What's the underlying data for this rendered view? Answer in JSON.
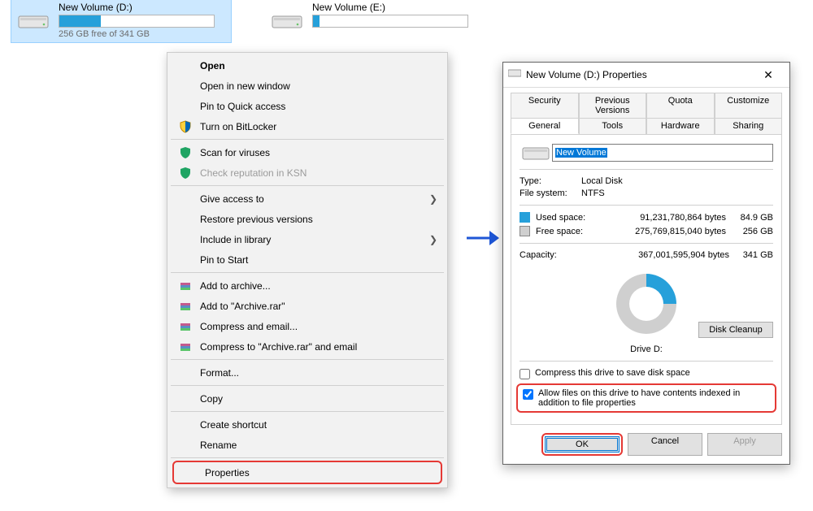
{
  "drives": [
    {
      "name": "New Volume (D:)",
      "free": "256 GB free of 341 GB",
      "used_pct": 27,
      "selected": true
    },
    {
      "name": "New Volume (E:)",
      "free": "",
      "used_pct": 4,
      "selected": false
    }
  ],
  "context_menu": {
    "open": "Open",
    "open_new_window": "Open in new window",
    "pin_quick": "Pin to Quick access",
    "bitlocker": "Turn on BitLocker",
    "scan_virus": "Scan for viruses",
    "check_ksn": "Check reputation in KSN",
    "give_access": "Give access to",
    "restore_prev": "Restore previous versions",
    "include_lib": "Include in library",
    "pin_start": "Pin to Start",
    "add_archive": "Add to archive...",
    "add_archive_rar": "Add to \"Archive.rar\"",
    "compress_email": "Compress and email...",
    "compress_rar_email": "Compress to \"Archive.rar\" and email",
    "format": "Format...",
    "copy": "Copy",
    "create_shortcut": "Create shortcut",
    "rename": "Rename",
    "properties": "Properties"
  },
  "dialog": {
    "title": "New Volume (D:) Properties",
    "tabs_row1": [
      "Security",
      "Previous Versions",
      "Quota",
      "Customize"
    ],
    "tabs_row2": [
      "General",
      "Tools",
      "Hardware",
      "Sharing"
    ],
    "volume_value": "New Volume",
    "type_label": "Type:",
    "type_value": "Local Disk",
    "fs_label": "File system:",
    "fs_value": "NTFS",
    "used_label": "Used space:",
    "used_bytes": "91,231,780,864 bytes",
    "used_h": "84.9 GB",
    "free_label": "Free space:",
    "free_bytes": "275,769,815,040 bytes",
    "free_h": "256 GB",
    "cap_label": "Capacity:",
    "cap_bytes": "367,001,595,904 bytes",
    "cap_h": "341 GB",
    "drive_caption": "Drive D:",
    "disk_cleanup": "Disk Cleanup",
    "compress_label": "Compress this drive to save disk space",
    "index_label": "Allow files on this drive to have contents indexed in addition to file properties",
    "ok": "OK",
    "cancel": "Cancel",
    "apply": "Apply"
  }
}
